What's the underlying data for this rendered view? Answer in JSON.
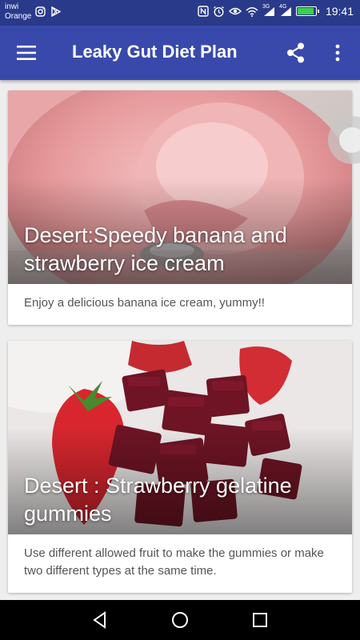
{
  "status_bar": {
    "carrier_line1": "inwi",
    "carrier_line2": "Orange",
    "time": "19:41",
    "signal_1_label": "3G",
    "signal_2_label": "4G",
    "battery_level": 0.9
  },
  "app_bar": {
    "title": "Leaky Gut Diet Plan",
    "menu_icon": "hamburger-menu-icon",
    "share_icon": "share-icon",
    "more_icon": "more-vert-icon"
  },
  "recipes": [
    {
      "title": "Desert:Speedy banana and strawberry ice cream",
      "description": "Enjoy a delicious banana ice cream, yummy!!"
    },
    {
      "title": "Desert : Strawberry gelatine gummies",
      "description": "Use different allowed fruit to make the gummies or make two different types at the same time."
    }
  ],
  "nav_bar": {
    "back_icon": "back-triangle-icon",
    "home_icon": "home-circle-icon",
    "recents_icon": "recents-square-icon"
  },
  "colors": {
    "app_bar": "#3949ab",
    "status_bar": "#2a3a8a",
    "background": "#eeeeee"
  }
}
